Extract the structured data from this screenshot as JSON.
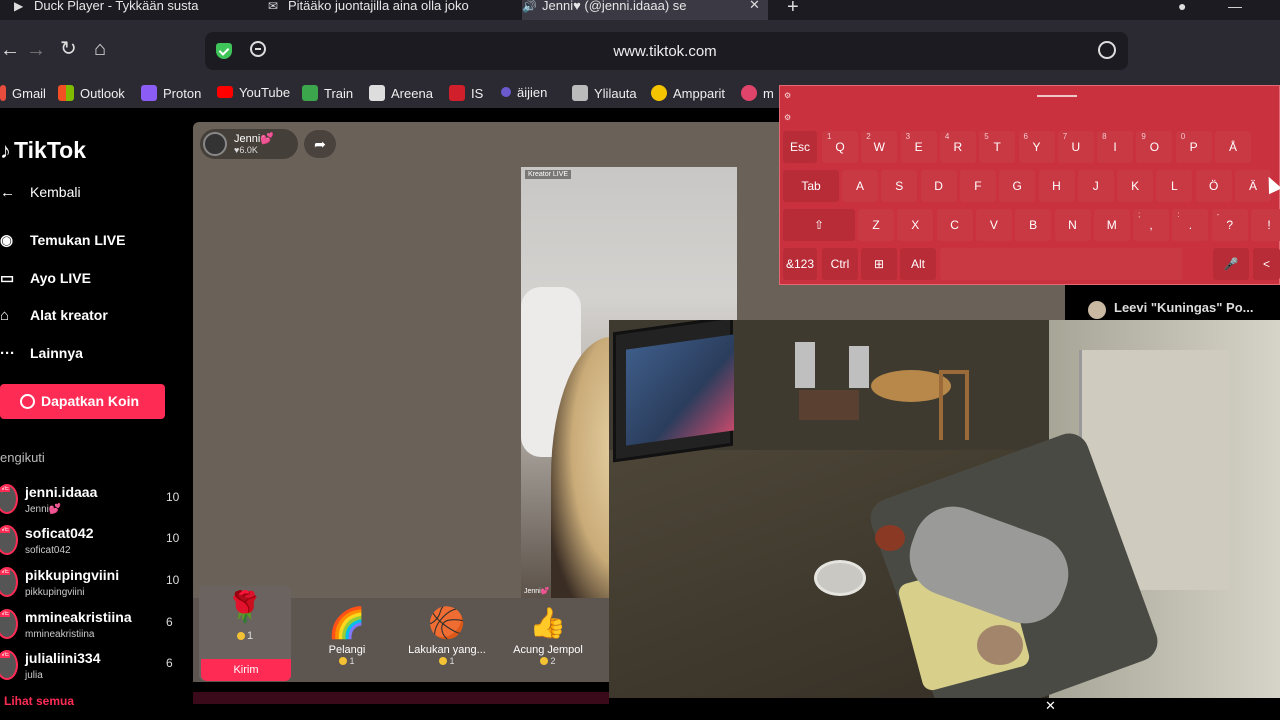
{
  "browser": {
    "tabs": [
      {
        "title": "Duck Player - Tykkään susta",
        "active": false
      },
      {
        "title": "Pitääko juontajilla aina olla joko",
        "active": false
      },
      {
        "title": "Jenni♥ (@jenni.idaaa) se",
        "active": true
      }
    ],
    "url": "www.tiktok.com",
    "bookmarks": [
      "Gmail",
      "Outlook",
      "Proton",
      "YouTube",
      "Train",
      "Areena",
      "IS",
      "äijien",
      "Ylilauta",
      "Ampparit",
      "m"
    ]
  },
  "sidebar": {
    "logo": "TikTok",
    "back_label": "Kembali",
    "nav": [
      {
        "label": "Temukan LIVE",
        "icon": "live-avatar-icon"
      },
      {
        "label": "Ayo LIVE",
        "icon": "camera-icon"
      },
      {
        "label": "Alat kreator",
        "icon": "creator-tools-icon"
      },
      {
        "label": "Lainnya",
        "icon": "more-icon"
      }
    ],
    "coin_button": "Dapatkan Koin",
    "following_header": "engikuti",
    "accounts": [
      {
        "username": "jenni.idaaa",
        "display": "Jenni💕",
        "count": "10"
      },
      {
        "username": "soficat042",
        "display": "soficat042",
        "count": "10"
      },
      {
        "username": "pikkupingviini",
        "display": "pikkupingviini",
        "count": "10"
      },
      {
        "username": "mmineakristiina",
        "display": "mmineakristiina",
        "count": "6"
      },
      {
        "username": "julialiini334",
        "display": "julia",
        "count": "6"
      }
    ],
    "see_all": "Lihat semua"
  },
  "live": {
    "host_name": "Jenni💕",
    "host_likes": "♥6.0K",
    "video_tag": "Kreator LIVE",
    "video_name": "Jenni💕"
  },
  "gifts": [
    {
      "name": "",
      "cost": "1",
      "icon": "🌹"
    },
    {
      "name": "Pelangi",
      "cost": "1",
      "icon": "🌈"
    },
    {
      "name": "Lakukan yang...",
      "cost": "1",
      "icon": "🏀"
    },
    {
      "name": "Acung Jempol",
      "cost": "2",
      "icon": "👍"
    }
  ],
  "send_label": "Kirim",
  "chat": {
    "user": "Leevi \"Kuningas\" Po..."
  },
  "keyboard": {
    "row1": [
      {
        "k": "Esc",
        "s": ""
      },
      {
        "k": "Q",
        "s": "1"
      },
      {
        "k": "W",
        "s": "2"
      },
      {
        "k": "E",
        "s": "3"
      },
      {
        "k": "R",
        "s": "4"
      },
      {
        "k": "T",
        "s": "5"
      },
      {
        "k": "Y",
        "s": "6"
      },
      {
        "k": "U",
        "s": "7"
      },
      {
        "k": "I",
        "s": "8"
      },
      {
        "k": "O",
        "s": "9"
      },
      {
        "k": "P",
        "s": "0"
      },
      {
        "k": "Å",
        "s": ""
      }
    ],
    "row2": [
      "Tab",
      "A",
      "S",
      "D",
      "F",
      "G",
      "H",
      "J",
      "K",
      "L",
      "Ö",
      "Ä"
    ],
    "row3": [
      {
        "k": "⇧",
        "s": ""
      },
      {
        "k": "Z",
        "s": ""
      },
      {
        "k": "X",
        "s": ""
      },
      {
        "k": "C",
        "s": ""
      },
      {
        "k": "V",
        "s": ""
      },
      {
        "k": "B",
        "s": ""
      },
      {
        "k": "N",
        "s": ""
      },
      {
        "k": "M",
        "s": ""
      },
      {
        "k": ",",
        "s": ";"
      },
      {
        "k": ".",
        "s": ":"
      },
      {
        "k": "?",
        "s": "-"
      },
      {
        "k": "!",
        "s": ""
      }
    ],
    "row4": [
      "&123",
      "Ctrl",
      "⊞",
      "Alt",
      "",
      "🎤",
      "<"
    ]
  },
  "colors": {
    "accent": "#fe2c55",
    "keyboard": "#c8313d"
  }
}
